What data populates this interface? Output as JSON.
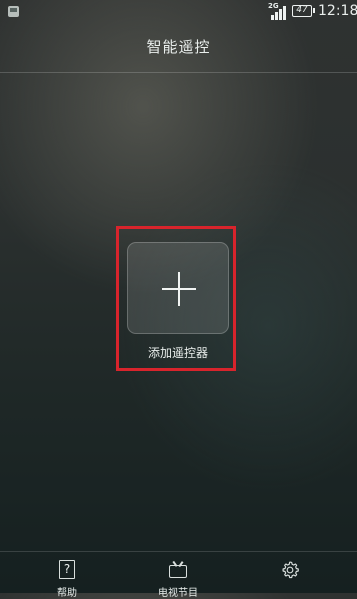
{
  "status_bar": {
    "network": "2G",
    "battery": "47",
    "time": "12:18"
  },
  "header": {
    "title": "智能遥控"
  },
  "main": {
    "add_remote_label": "添加遥控器"
  },
  "bottom_nav": {
    "items": [
      {
        "label": "帮助",
        "icon": "help-icon"
      },
      {
        "label": "电视节目",
        "icon": "tv-icon"
      },
      {
        "label": "",
        "icon": "gear-icon"
      }
    ]
  },
  "colors": {
    "highlight_box": "#d8242c"
  }
}
